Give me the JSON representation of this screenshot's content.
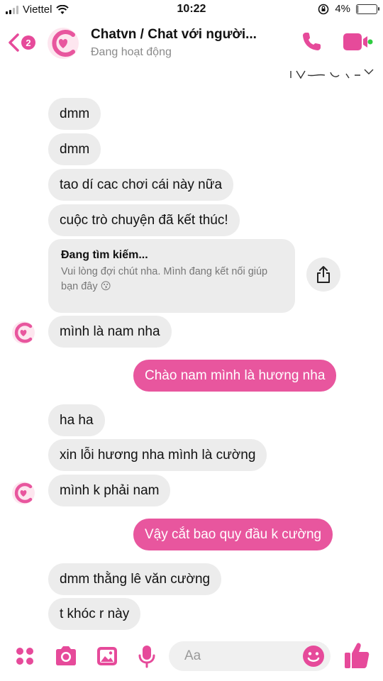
{
  "status_bar": {
    "carrier": "Viettel",
    "time": "10:22",
    "battery": "4%",
    "battery_level": 0.04
  },
  "header": {
    "title": "Chatvn / Chat với người...",
    "subtitle": "Đang hoạt động",
    "back_badge": "2"
  },
  "colors": {
    "accent": "#e8569e",
    "incoming_bubble": "#ececec",
    "icon_pink": "#e64a9a"
  },
  "messages": [
    {
      "dir": "in",
      "text": "dmm"
    },
    {
      "dir": "in",
      "text": "dmm"
    },
    {
      "dir": "in",
      "text": "tao dí cac chơi cái này nữa"
    },
    {
      "dir": "in",
      "text": "cuộc trò chuyện đã kết thúc!"
    },
    {
      "dir": "in",
      "text": "mình là nam nha"
    },
    {
      "dir": "out",
      "text": "Chào nam mình là hương nha"
    },
    {
      "dir": "in",
      "text": "ha ha"
    },
    {
      "dir": "in",
      "text": "xin lỗi hương nha mình là  cường"
    },
    {
      "dir": "in",
      "text": "mình k phải nam"
    },
    {
      "dir": "out",
      "text": "Vậy cắt bao quy đầu k cường"
    },
    {
      "dir": "in",
      "text": "dmm thằng lê văn cường"
    },
    {
      "dir": "in",
      "text": "t khóc r này"
    }
  ],
  "card": {
    "title": "Đang tìm kiếm...",
    "body": "Vui lòng đợi chút nha. Mình đang kết nối giúp bạn đây 😗"
  },
  "composer": {
    "placeholder": "Aa",
    "icons": [
      "apps-icon",
      "camera-icon",
      "image-icon",
      "microphone-icon",
      "emoji-icon",
      "thumbs-up-icon"
    ]
  }
}
